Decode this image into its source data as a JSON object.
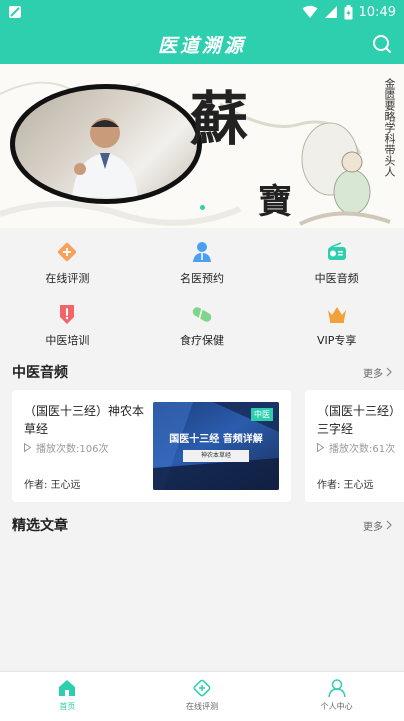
{
  "status_bar": {
    "time": "10:49"
  },
  "app_bar": {
    "title": "医道溯源"
  },
  "banner": {
    "calligraphy_main": "蘇",
    "calligraphy_sub": "寶",
    "side_text": "金匮要略学科带头人"
  },
  "quick_menu": [
    {
      "label": "在线评测",
      "icon": "plus-diamond-icon",
      "color": "#f5a25d"
    },
    {
      "label": "名医预约",
      "icon": "doctor-icon",
      "color": "#4a9ff5"
    },
    {
      "label": "中医音频",
      "icon": "radio-icon",
      "color": "#2dcfaf"
    },
    {
      "label": "中医培训",
      "icon": "badge-icon",
      "color": "#f2666a"
    },
    {
      "label": "食疗保健",
      "icon": "pill-icon",
      "color": "#7ed58b"
    },
    {
      "label": "VIP专享",
      "icon": "crown-icon",
      "color": "#f2a23a"
    }
  ],
  "sections": {
    "audio": {
      "title": "中医音频",
      "more": "更多"
    },
    "articles": {
      "title": "精选文章",
      "more": "更多"
    }
  },
  "audio_cards": [
    {
      "title": "（国医十三经）神农本草经",
      "plays": "播放次数:106次",
      "author": "作者: 王心远",
      "thumb_tag": "中医",
      "thumb_title": "国医十三经 音频详解",
      "thumb_sub": "神农本草经"
    },
    {
      "title": "（国医十三经）三字经",
      "plays": "播放次数:61次",
      "author": "作者: 王心远"
    }
  ],
  "tabbar": [
    {
      "label": "首页",
      "active": true
    },
    {
      "label": "在线评测",
      "active": false
    },
    {
      "label": "个人中心",
      "active": false
    }
  ],
  "colors": {
    "accent": "#2dcfaf"
  }
}
